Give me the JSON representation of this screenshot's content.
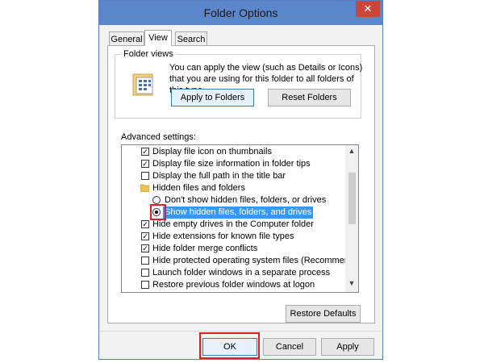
{
  "window": {
    "title": "Folder Options",
    "close_glyph": "✕"
  },
  "tabs": [
    {
      "label": "General",
      "active": false
    },
    {
      "label": "View",
      "active": true
    },
    {
      "label": "Search",
      "active": false
    }
  ],
  "folder_views": {
    "group_label": "Folder views",
    "description": "You can apply the view (such as Details or Icons) that you are using for this folder to all folders of this type.",
    "icon": "folder-view-icon",
    "apply_label": "Apply to Folders",
    "reset_label": "Reset Folders"
  },
  "advanced": {
    "label": "Advanced settings:",
    "items": [
      {
        "kind": "checkbox",
        "checked": true,
        "label": "Display file icon on thumbnails"
      },
      {
        "kind": "checkbox",
        "checked": true,
        "label": "Display file size information in folder tips"
      },
      {
        "kind": "checkbox",
        "checked": false,
        "label": "Display the full path in the title bar"
      },
      {
        "kind": "folder",
        "label": "Hidden files and folders"
      },
      {
        "kind": "radio",
        "checked": false,
        "label": "Don't show hidden files, folders, or drives"
      },
      {
        "kind": "radio",
        "checked": true,
        "label": "Show hidden files, folders, and drives",
        "selected": true
      },
      {
        "kind": "checkbox",
        "checked": true,
        "label": "Hide empty drives in the Computer folder"
      },
      {
        "kind": "checkbox",
        "checked": true,
        "label": "Hide extensions for known file types"
      },
      {
        "kind": "checkbox",
        "checked": true,
        "label": "Hide folder merge conflicts"
      },
      {
        "kind": "checkbox",
        "checked": false,
        "label": "Hide protected operating system files (Recommended)"
      },
      {
        "kind": "checkbox",
        "checked": false,
        "label": "Launch folder windows in a separate process"
      },
      {
        "kind": "checkbox",
        "checked": false,
        "label": "Restore previous folder windows at logon"
      }
    ],
    "restore_label": "Restore Defaults"
  },
  "footer": {
    "ok_label": "OK",
    "cancel_label": "Cancel",
    "apply_label": "Apply"
  },
  "colors": {
    "titlebar": "#5b86cb",
    "close": "#c9463d",
    "highlight": "#e02020",
    "selection": "#3399ff"
  }
}
